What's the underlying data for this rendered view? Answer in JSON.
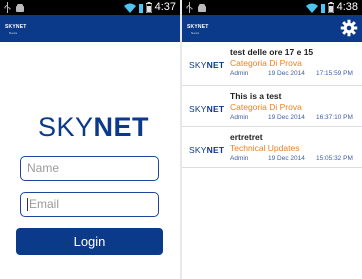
{
  "status_bar": {
    "left_time": "4:37",
    "right_time": "4:38"
  },
  "brand": {
    "sky": "SKY",
    "net": "NET",
    "appbar_name": "SKYNET",
    "appbar_sub": "News"
  },
  "login": {
    "name_placeholder": "Name",
    "email_placeholder": "Email",
    "login_label": "Login"
  },
  "news": {
    "items": [
      {
        "title": "test delle ore 17 e 15",
        "category": "Categoria Di Prova",
        "author": "Admin",
        "date": "19 Dec 2014",
        "time": "17:15:59 PM"
      },
      {
        "title": "This is a test",
        "category": "Categoria Di Prova",
        "author": "Admin",
        "date": "19 Dec 2014",
        "time": "16:37:10 PM"
      },
      {
        "title": "ertretret",
        "category": "Technical Updates",
        "author": "Admin",
        "date": "19 Dec 2014",
        "time": "15:05:32 PM"
      }
    ]
  },
  "colors": {
    "brand_blue": "#0b3a8a",
    "category_orange": "#f07f1e",
    "status_bar": "#000000",
    "wifi_green": "#49c7f0"
  },
  "icons": [
    "usb-icon",
    "android-icon",
    "wifi-icon",
    "battery-icon",
    "gear-icon"
  ]
}
